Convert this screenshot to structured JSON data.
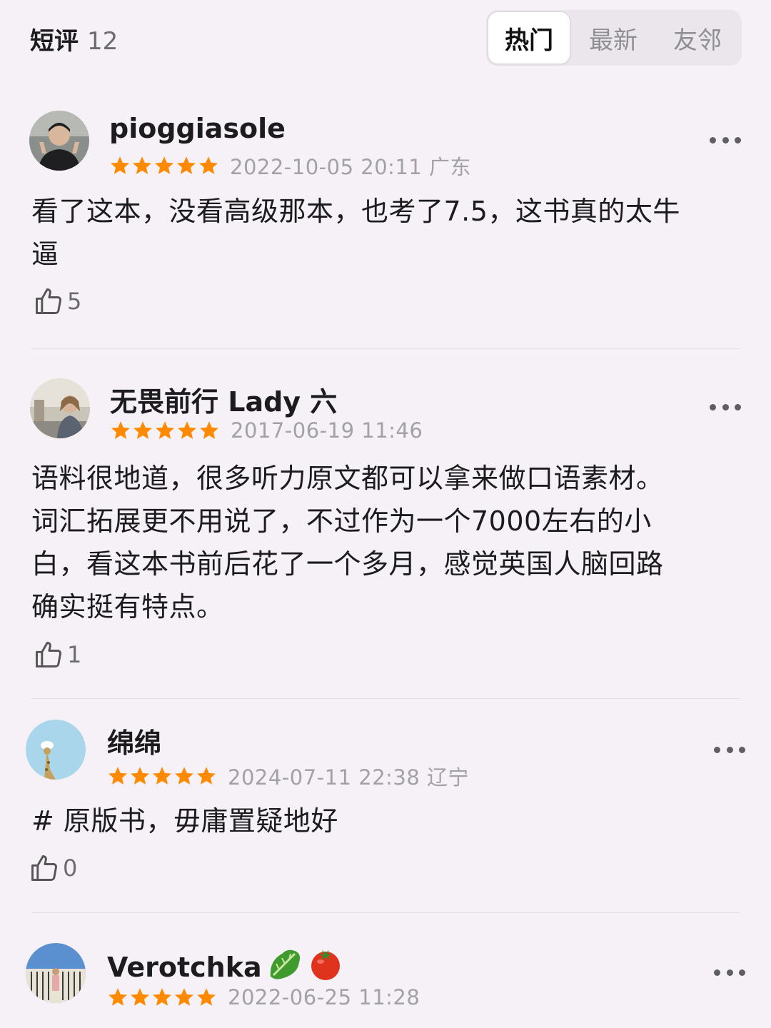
{
  "header": {
    "title": "短评",
    "count": "12",
    "tabs": [
      {
        "label": "热门",
        "active": true
      },
      {
        "label": "最新",
        "active": false
      },
      {
        "label": "友邻",
        "active": false
      }
    ]
  },
  "reviews": [
    {
      "username": "pioggiasole",
      "rating": 5,
      "meta": "2022-10-05 20:11 广东",
      "content_lines": [
        "看了这本，没看高级那本，也考了7.5，这书真的太牛",
        "逼"
      ],
      "likes": "5"
    },
    {
      "username": "无畏前行 Lady 六",
      "rating": 5,
      "meta": "2017-06-19 11:46",
      "content_lines": [
        "语料很地道，很多听力原文都可以拿来做口语素材。",
        "词汇拓展更不用说了，不过作为一个7000左右的小",
        "白，看这本书前后花了一个多月，感觉英国人脑回路",
        "确实挺有特点。"
      ],
      "likes": "1"
    },
    {
      "username": "绵绵",
      "rating": 5,
      "meta": "2024-07-11 22:38 辽宁",
      "content_lines": [
        "# 原版书，毋庸置疑地好"
      ],
      "likes": "0"
    },
    {
      "username": "Verotchka",
      "username_icons": [
        "lettuce-emoji",
        "tomato-emoji"
      ],
      "rating": 5,
      "meta": "2022-06-25 11:28"
    }
  ],
  "colors": {
    "background": "#f6f1f7",
    "star": "#ff8a00",
    "meta_text": "#a1a1a6"
  }
}
